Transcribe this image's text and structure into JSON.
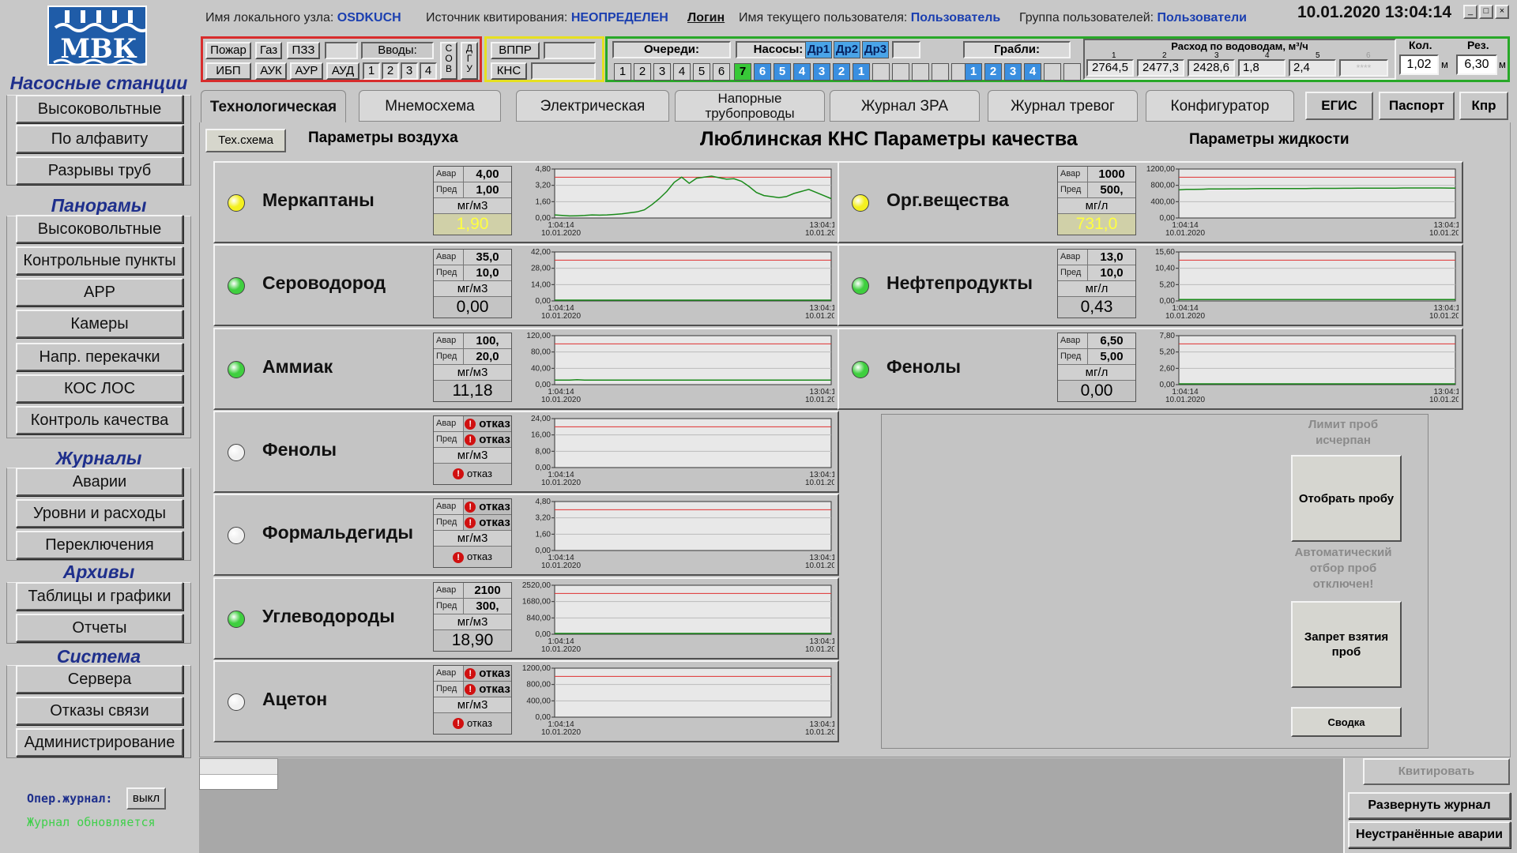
{
  "sidebar": {
    "sec_stations": "Насосные  станции",
    "stations": [
      "Высоковольтные",
      "По алфавиту",
      "Разрывы труб"
    ],
    "sec_panoramas": "Панорамы",
    "panoramas": [
      "Высоковольтные",
      "Контрольные пункты",
      "АРР",
      "Камеры",
      "Напр. перекачки",
      "КОС ЛОС",
      "Контроль качества"
    ],
    "sec_journals": "Журналы",
    "journals": [
      "Аварии",
      "Уровни и расходы",
      "Переключения"
    ],
    "sec_archives": "Архивы",
    "archives": [
      "Таблицы и графики",
      "Отчеты"
    ],
    "sec_system": "Система",
    "system": [
      "Сервера",
      "Отказы связи",
      "Администрирование"
    ],
    "oper_label": "Опер.журнал:",
    "oper_btn": "выкл",
    "journal_status": "Журнал обновляется"
  },
  "logo_text": "МВК",
  "header": {
    "node_label": "Имя локального узла:",
    "node_value": "OSDKUCH",
    "ack_label": "Источник квитирования:",
    "ack_value": "НЕОПРЕДЕЛЕН",
    "login": "Логин",
    "user_label": "Имя текущего пользователя:",
    "user_value": "Пользователь",
    "group_label": "Группа пользователей:",
    "group_value": "Пользователи",
    "datetime": "10.01.2020  13:04:14"
  },
  "toolbar": {
    "pozhar": "Пожар",
    "gaz": "Газ",
    "pzz": "ПЗЗ",
    "vvody": "Вводы:",
    "ibp": "ИБП",
    "auk": "АУК",
    "aur": "АУР",
    "aud": "АУД",
    "vvody_nums": [
      "1",
      "2",
      "3",
      "4"
    ],
    "sov": "С\nО\nВ",
    "dgu": "Д\nГ\nУ",
    "vppr": "ВППР",
    "kns": "КНС",
    "queues_label": "Очереди:",
    "queues": [
      "1",
      "2",
      "3",
      "4",
      "5",
      "6"
    ],
    "pumps_label": "Насосы:",
    "dr": [
      "Др1",
      "Др2",
      "Др3"
    ],
    "pumps": [
      "7",
      "6",
      "5",
      "4",
      "3",
      "2",
      "1"
    ],
    "grabli_label": "Грабли:",
    "grabli": [
      "1",
      "2",
      "3",
      "4"
    ],
    "flow_label": "Расход по водоводам, м³/ч",
    "flow_nums": [
      "1",
      "2",
      "3",
      "4",
      "5",
      "6"
    ],
    "flow_vals": [
      "2764,5",
      "2477,3",
      "2428,6",
      "1,8",
      "2,4",
      "****"
    ],
    "kol_label": "Кол.",
    "kol_val": "1,02",
    "kol_unit": "м",
    "rez_label": "Рез.",
    "rez_val": "6,30",
    "rez_unit": "м"
  },
  "tabs": [
    "Технологическая",
    "Мнемосхема",
    "Электрическая",
    "Напорные трубопроводы",
    "Журнал ЗРА",
    "Журнал тревог",
    "Конфигуратор"
  ],
  "tabs_right": [
    "ЕГИС",
    "Паспорт",
    "Кпр"
  ],
  "subheader": {
    "tex_button": "Тех.схема",
    "air_title": "Параметры воздуха",
    "main_title": "Люблинская КНС Параметры качества",
    "liquid_title": "Параметры жидкости"
  },
  "labels": {
    "avar": "Авар",
    "pred": "Пред",
    "fault": "отказ",
    "t_start": "1:04:14",
    "t_end": "13:04:14",
    "date": "10.01.2020"
  },
  "air_params": [
    {
      "name": "Меркаптаны",
      "status": "yellow",
      "avar": "4,00",
      "pred": "1,00",
      "unit": "мг/м3",
      "value": "1,90",
      "warn": true,
      "yticks": [
        "4,80",
        "3,20",
        "1,60",
        "0,00"
      ],
      "ymax": 4.8,
      "redline": 4.0,
      "series": [
        0.3,
        0.25,
        0.2,
        0.22,
        0.25,
        0.3,
        0.28,
        0.3,
        0.35,
        0.4,
        0.5,
        0.6,
        0.8,
        1.3,
        1.9,
        2.6,
        3.5,
        4.0,
        3.4,
        3.9,
        4.0,
        4.1,
        3.95,
        3.8,
        3.85,
        3.6,
        3.1,
        2.5,
        2.2,
        2.1,
        2.0,
        2.1,
        2.4,
        2.6,
        2.8,
        2.5,
        2.2,
        1.9
      ]
    },
    {
      "name": "Сероводород",
      "status": "green",
      "avar": "35,0",
      "pred": "10,0",
      "unit": "мг/м3",
      "value": "0,00",
      "warn": false,
      "yticks": [
        "42,00",
        "28,00",
        "14,00",
        "0,00"
      ],
      "ymax": 42,
      "redline": 35,
      "series": [
        0,
        0,
        0,
        0,
        0,
        0,
        0,
        0,
        0,
        0,
        0,
        0,
        0,
        0.4,
        0.5,
        0.5,
        0.4,
        0,
        0,
        0,
        0,
        0,
        0,
        0,
        0,
        0,
        0,
        0,
        0,
        0,
        0,
        0,
        0,
        0,
        0,
        0,
        0,
        0
      ]
    },
    {
      "name": "Аммиак",
      "status": "green",
      "avar": "100,",
      "pred": "20,0",
      "unit": "мг/м3",
      "value": "11,18",
      "warn": false,
      "yticks": [
        "120,00",
        "80,00",
        "40,00",
        "0,00"
      ],
      "ymax": 120,
      "redline": 100,
      "series": [
        11,
        11,
        11,
        12,
        11,
        11,
        11,
        11,
        11,
        11,
        11,
        11,
        11,
        11,
        11,
        11,
        11,
        11,
        11,
        11,
        11,
        11,
        11,
        11,
        11,
        11,
        11,
        11,
        11,
        11,
        11,
        11,
        11,
        11,
        11,
        11,
        11,
        11
      ]
    },
    {
      "name": "Фенолы",
      "status": "white",
      "avar": null,
      "pred": null,
      "unit": "мг/м3",
      "value": null,
      "warn": false,
      "yticks": [
        "24,00",
        "16,00",
        "8,00",
        "0,00"
      ],
      "ymax": 24,
      "redline": 20,
      "series": []
    },
    {
      "name": "Формальдегиды",
      "status": "white",
      "avar": null,
      "pred": null,
      "unit": "мг/м3",
      "value": null,
      "warn": false,
      "yticks": [
        "4,80",
        "3,20",
        "1,60",
        "0,00"
      ],
      "ymax": 4.8,
      "redline": 4.0,
      "series": []
    },
    {
      "name": "Углеводороды",
      "status": "green",
      "avar": "2100",
      "pred": "300,",
      "unit": "мг/м3",
      "value": "18,90",
      "warn": false,
      "yticks": [
        "2520,00",
        "1680,00",
        "840,00",
        "0,00"
      ],
      "ymax": 2520,
      "redline": 2100,
      "series": [
        18,
        18,
        19,
        18,
        18,
        18,
        18,
        18,
        18,
        18,
        18,
        18,
        18,
        18,
        18,
        18,
        18,
        18,
        18,
        18,
        18,
        18,
        18,
        18,
        18,
        18,
        18,
        18,
        18,
        18,
        18,
        18,
        18,
        18,
        18,
        18,
        18,
        18
      ]
    },
    {
      "name": "Ацетон",
      "status": "white",
      "avar": null,
      "pred": null,
      "unit": "мг/м3",
      "value": null,
      "warn": false,
      "yticks": [
        "1200,00",
        "800,00",
        "400,00",
        "0,00"
      ],
      "ymax": 1200,
      "redline": 1000,
      "series": []
    }
  ],
  "liquid_params": [
    {
      "name": "Орг.вещества",
      "status": "yellow",
      "avar": "1000",
      "pred": "500,",
      "unit": "мг/л",
      "value": "731,0",
      "warn": true,
      "yticks": [
        "1200,00",
        "800,00",
        "400,00",
        "0,00"
      ],
      "ymax": 1200,
      "redline": 1000,
      "series": [
        690,
        700,
        700,
        705,
        710,
        710,
        712,
        715,
        715,
        715,
        718,
        720,
        720,
        720,
        722,
        722,
        720,
        722,
        725,
        725,
        725,
        725,
        728,
        728,
        730,
        730,
        730,
        730,
        732,
        732,
        735,
        735,
        735,
        735,
        735,
        735,
        733,
        731
      ]
    },
    {
      "name": "Нефтепродукты",
      "status": "green",
      "avar": "13,0",
      "pred": "10,0",
      "unit": "мг/л",
      "value": "0,43",
      "warn": false,
      "yticks": [
        "15,60",
        "10,40",
        "5,20",
        "0,00"
      ],
      "ymax": 15.6,
      "redline": 13,
      "series": [
        0.43,
        0.43,
        0.43,
        0.43,
        0.43,
        0.43,
        0.43,
        0.43,
        0.43,
        0.43,
        0.43,
        0.43,
        0.43,
        0.43,
        0.43,
        0.43,
        0.43,
        0.43,
        0.43,
        0.43,
        0.43,
        0.43,
        0.43,
        0.43,
        0.43,
        0.43,
        0.43,
        0.43,
        0.43,
        0.43,
        0.43,
        0.43,
        0.43,
        0.43,
        0.43,
        0.43,
        0.43,
        0.43
      ]
    },
    {
      "name": "Фенолы",
      "status": "green",
      "avar": "6,50",
      "pred": "5,00",
      "unit": "мг/л",
      "value": "0,00",
      "warn": false,
      "yticks": [
        "7,80",
        "5,20",
        "2,60",
        "0,00"
      ],
      "ymax": 7.8,
      "redline": 6.5,
      "series": [
        0,
        0.05,
        0,
        0.05,
        0,
        0,
        0.05,
        0,
        0.05,
        0,
        0,
        0.05,
        0,
        0,
        0.05,
        0,
        0.05,
        0,
        0,
        0.05,
        0,
        0,
        0.05,
        0,
        0.05,
        0,
        0,
        0.05,
        0,
        0.05,
        0,
        0,
        0.05,
        0,
        0,
        0.05,
        0,
        0
      ]
    }
  ],
  "sampler": {
    "limit_text": "Лимит проб исчерпан",
    "take_btn": "Отобрать пробу",
    "auto_text": "Автоматический отбор проб отключен!",
    "ban_btn": "Запрет взятия проб",
    "summary_btn": "Сводка"
  },
  "bottom": {
    "ack_btn": "Квитировать",
    "expand_btn": "Развернуть журнал",
    "unresolved_btn": "Неустранённые аварии"
  },
  "colors": {
    "green_lamp": "#3fcf3f",
    "yellow_lamp": "#f4f020",
    "white_lamp": "#f0f0f0",
    "chart_line": "#1a8a1a",
    "red_line": "#e03030",
    "accent_blue": "#1b3fb0"
  }
}
